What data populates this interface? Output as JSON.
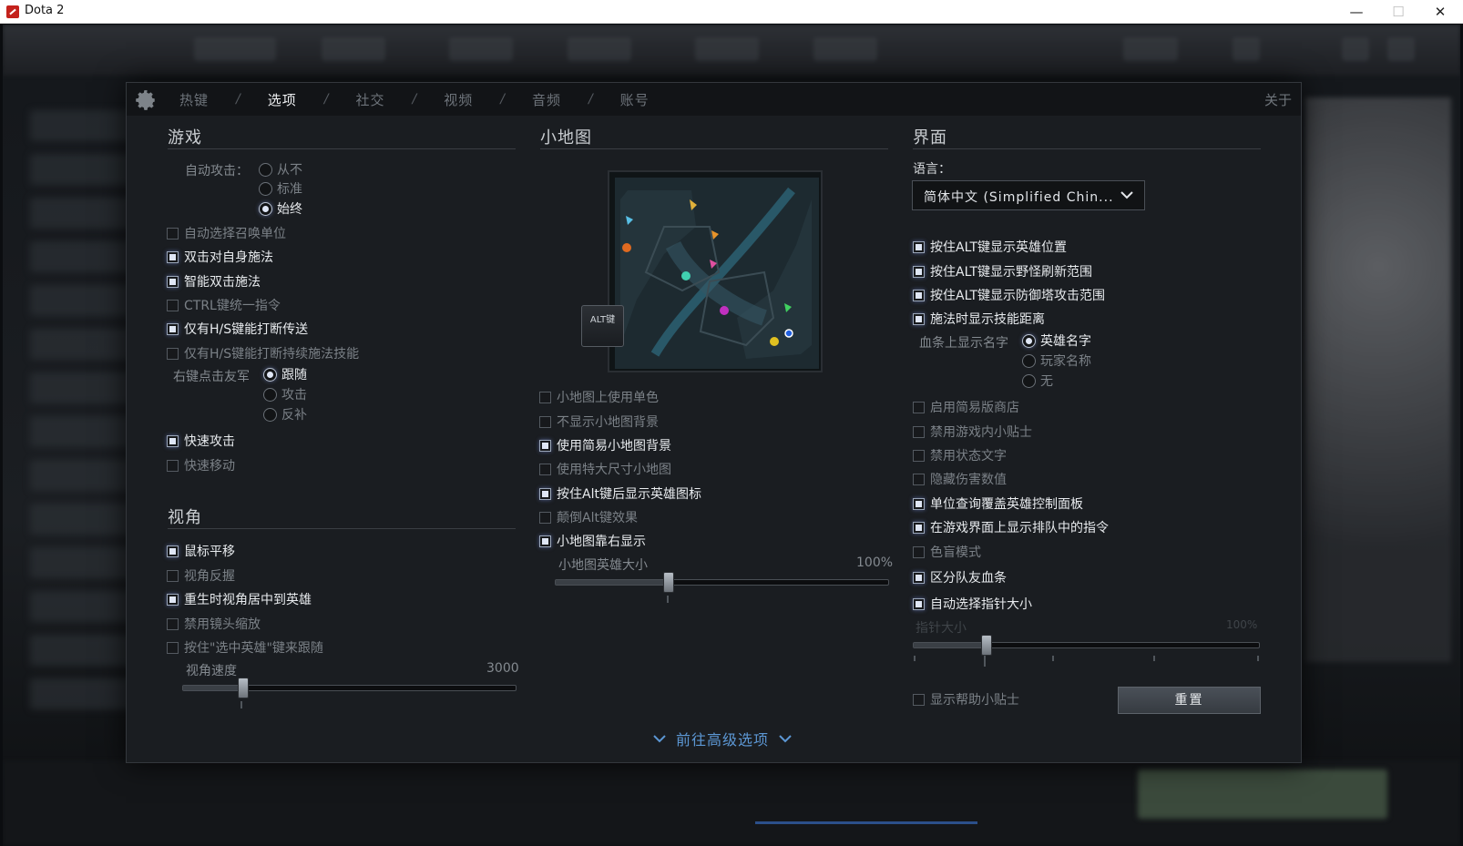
{
  "window": {
    "title": "Dota 2",
    "controls": {
      "minimize": "—",
      "maximize": "☐",
      "close": "✕"
    }
  },
  "tabs": [
    {
      "label": "热键",
      "active": false
    },
    {
      "label": "选项",
      "active": true
    },
    {
      "label": "社交",
      "active": false
    },
    {
      "label": "视频",
      "active": false
    },
    {
      "label": "音频",
      "active": false
    },
    {
      "label": "账号",
      "active": false
    }
  ],
  "tab_separator": "/",
  "about_label": "关于",
  "game": {
    "title": "游戏",
    "auto_attack_label": "自动攻击：",
    "auto_attack_options": [
      {
        "label": "从不",
        "selected": false
      },
      {
        "label": "标准",
        "selected": false
      },
      {
        "label": "始终",
        "selected": true
      }
    ],
    "options": [
      {
        "label": "自动选择召唤单位",
        "checked": false
      },
      {
        "label": "双击对自身施法",
        "checked": true
      },
      {
        "label": "智能双击施法",
        "checked": true
      },
      {
        "label": "CTRL键统一指令",
        "checked": false
      },
      {
        "label": "仅有H/S键能打断传送",
        "checked": true
      },
      {
        "label": "仅有H/S键能打断持续施法技能",
        "checked": false
      }
    ],
    "right_click_label": "右键点击友军",
    "right_click_options": [
      {
        "label": "跟随",
        "selected": true
      },
      {
        "label": "攻击",
        "selected": false
      },
      {
        "label": "反补",
        "selected": false
      }
    ],
    "options2": [
      {
        "label": "快速攻击",
        "checked": true
      },
      {
        "label": "快速移动",
        "checked": false
      }
    ]
  },
  "camera": {
    "title": "视角",
    "options": [
      {
        "label": "鼠标平移",
        "checked": true
      },
      {
        "label": "视角反握",
        "checked": false
      },
      {
        "label": "重生时视角居中到英雄",
        "checked": true
      },
      {
        "label": "禁用镜头缩放",
        "checked": false
      },
      {
        "label": "按住\"选中英雄\"键来跟随",
        "checked": false
      }
    ],
    "speed_label": "视角速度",
    "speed_value_text": "3000",
    "speed_fraction": 0.18
  },
  "minimap": {
    "title": "小地图",
    "alt_key_label": "ALT键",
    "options": [
      {
        "label": "小地图上使用单色",
        "checked": false
      },
      {
        "label": "不显示小地图背景",
        "checked": false
      },
      {
        "label": "使用简易小地图背景",
        "checked": true
      },
      {
        "label": "使用特大尺寸小地图",
        "checked": false
      },
      {
        "label": "按住Alt键后显示英雄图标",
        "checked": true
      },
      {
        "label": "颠倒Alt键效果",
        "checked": false
      },
      {
        "label": "小地图靠右显示",
        "checked": true
      }
    ],
    "hero_size_label": "小地图英雄大小",
    "hero_size_value_text": "100%",
    "hero_size_fraction": 0.34
  },
  "interface": {
    "title": "界面",
    "language_label": "语言：",
    "language_value": "简体中文 (Simplified Chin...",
    "options": [
      {
        "label": "按住ALT键显示英雄位置",
        "checked": true
      },
      {
        "label": "按住ALT键显示野怪刷新范围",
        "checked": true
      },
      {
        "label": "按住ALT键显示防御塔攻击范围",
        "checked": true
      },
      {
        "label": "施法时显示技能距离",
        "checked": true
      }
    ],
    "healthbar_name_label": "血条上显示名字",
    "healthbar_name_options": [
      {
        "label": "英雄名字",
        "selected": true
      },
      {
        "label": "玩家名称",
        "selected": false
      },
      {
        "label": "无",
        "selected": false
      }
    ],
    "options2": [
      {
        "label": "启用简易版商店",
        "checked": false
      },
      {
        "label": "禁用游戏内小贴士",
        "checked": false
      },
      {
        "label": "禁用状态文字",
        "checked": false
      },
      {
        "label": "隐藏伤害数值",
        "checked": false
      },
      {
        "label": "单位查询覆盖英雄控制面板",
        "checked": true
      },
      {
        "label": "在游戏界面上显示排队中的指令",
        "checked": true
      },
      {
        "label": "色盲模式",
        "checked": false
      },
      {
        "label": "区分队友血条",
        "checked": true
      },
      {
        "label": "自动选择指针大小",
        "checked": true
      }
    ],
    "cursor_size_label": "指针大小",
    "cursor_size_value_text": "100%",
    "cursor_size_fraction": 0.21,
    "show_help_tips": {
      "label": "显示帮助小贴士",
      "checked": false
    },
    "reset_label": "重置"
  },
  "advanced_label": "前往高级选项",
  "colors": {
    "accent_blue": "#5c97d4",
    "checked_text": "#e8ebee",
    "unchecked_text": "#7b8187",
    "panel_bg": "#1a1d21"
  }
}
